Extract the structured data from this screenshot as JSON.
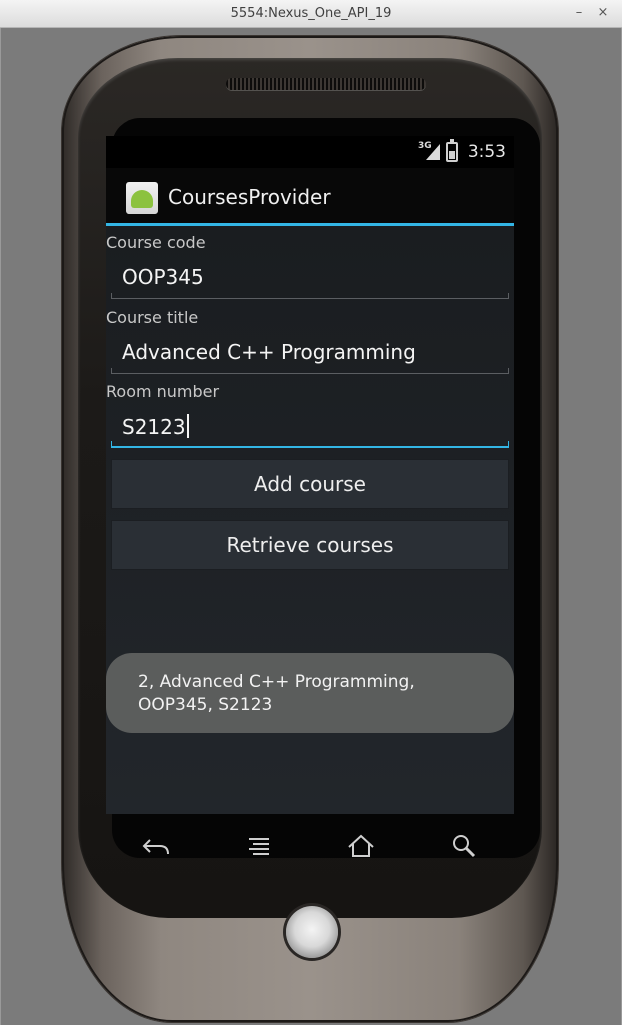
{
  "window": {
    "title": "5554:Nexus_One_API_19",
    "minimize": "–",
    "close": "×"
  },
  "status_bar": {
    "network": "3G",
    "time": "3:53",
    "icons": [
      "signal-icon",
      "battery-icon"
    ]
  },
  "action_bar": {
    "title": "CoursesProvider",
    "icon": "android-app-icon"
  },
  "form": {
    "course_code": {
      "label": "Course code",
      "value": "OOP345"
    },
    "course_title": {
      "label": "Course title",
      "value": "Advanced C++ Programming"
    },
    "room_number": {
      "label": "Room number",
      "value": "S2123"
    }
  },
  "buttons": {
    "add": "Add course",
    "retrieve": "Retrieve courses"
  },
  "toast": {
    "text": "2, Advanced C++ Programming, OOP345, S2123"
  },
  "nav_bar": {
    "icons": [
      "back-icon",
      "menu-icon",
      "home-icon",
      "search-icon"
    ]
  },
  "colors": {
    "accent": "#33b5e5",
    "screen_bg": "#22262b",
    "button_bg": "#2a2f35",
    "toast_bg": "#5b5d5c"
  }
}
